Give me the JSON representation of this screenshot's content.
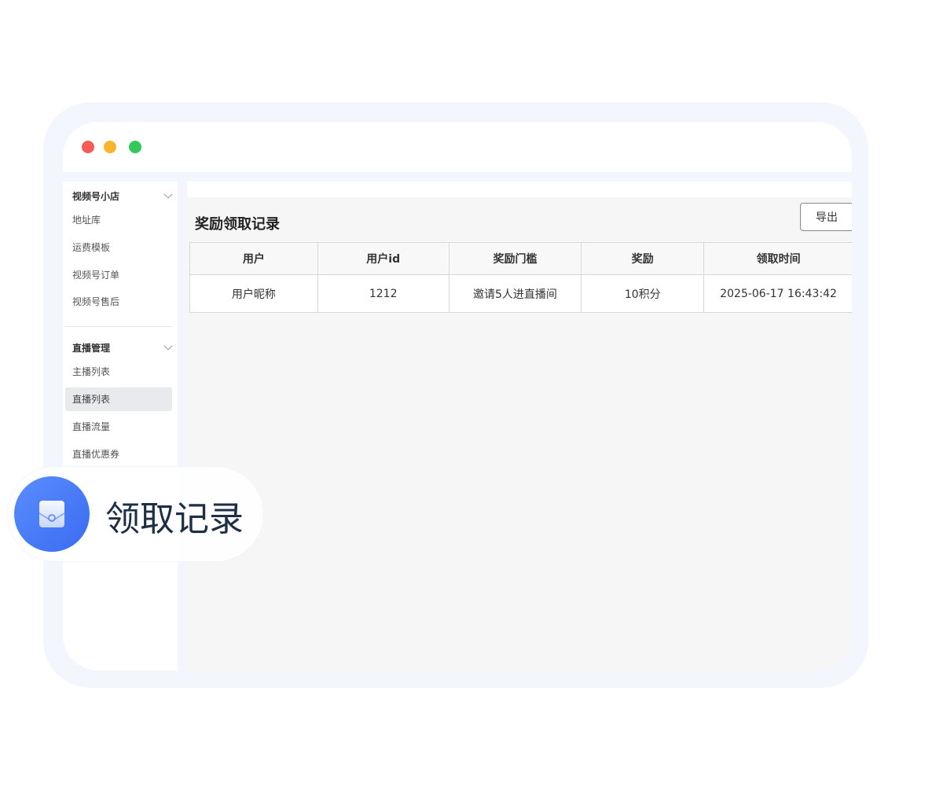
{
  "sidebar": {
    "sections": [
      {
        "title": "视频号小店",
        "items": [
          "地址库",
          "运费模板",
          "视频号订单",
          "视频号售后"
        ]
      },
      {
        "title": "直播管理",
        "items": [
          "主播列表",
          "直播列表",
          "直播流量",
          "直播优惠券"
        ]
      }
    ],
    "active_item": "直播列表"
  },
  "main": {
    "page_title": "奖励领取记录",
    "export_label": "导出",
    "table": {
      "columns": [
        "用户",
        "用户id",
        "奖励门槛",
        "奖励",
        "领取时间"
      ],
      "rows": [
        [
          "用户昵称",
          "1212",
          "邀请5人进直播间",
          "10积分",
          "2025-06-17 16:43:42"
        ]
      ]
    }
  },
  "badge": {
    "label": "领取记录",
    "icon": "envelope-icon",
    "accent": "#4a7bff"
  },
  "window_controls": {
    "close_color": "#f45c55",
    "minimize_color": "#fbb52c",
    "maximize_color": "#34c759"
  }
}
